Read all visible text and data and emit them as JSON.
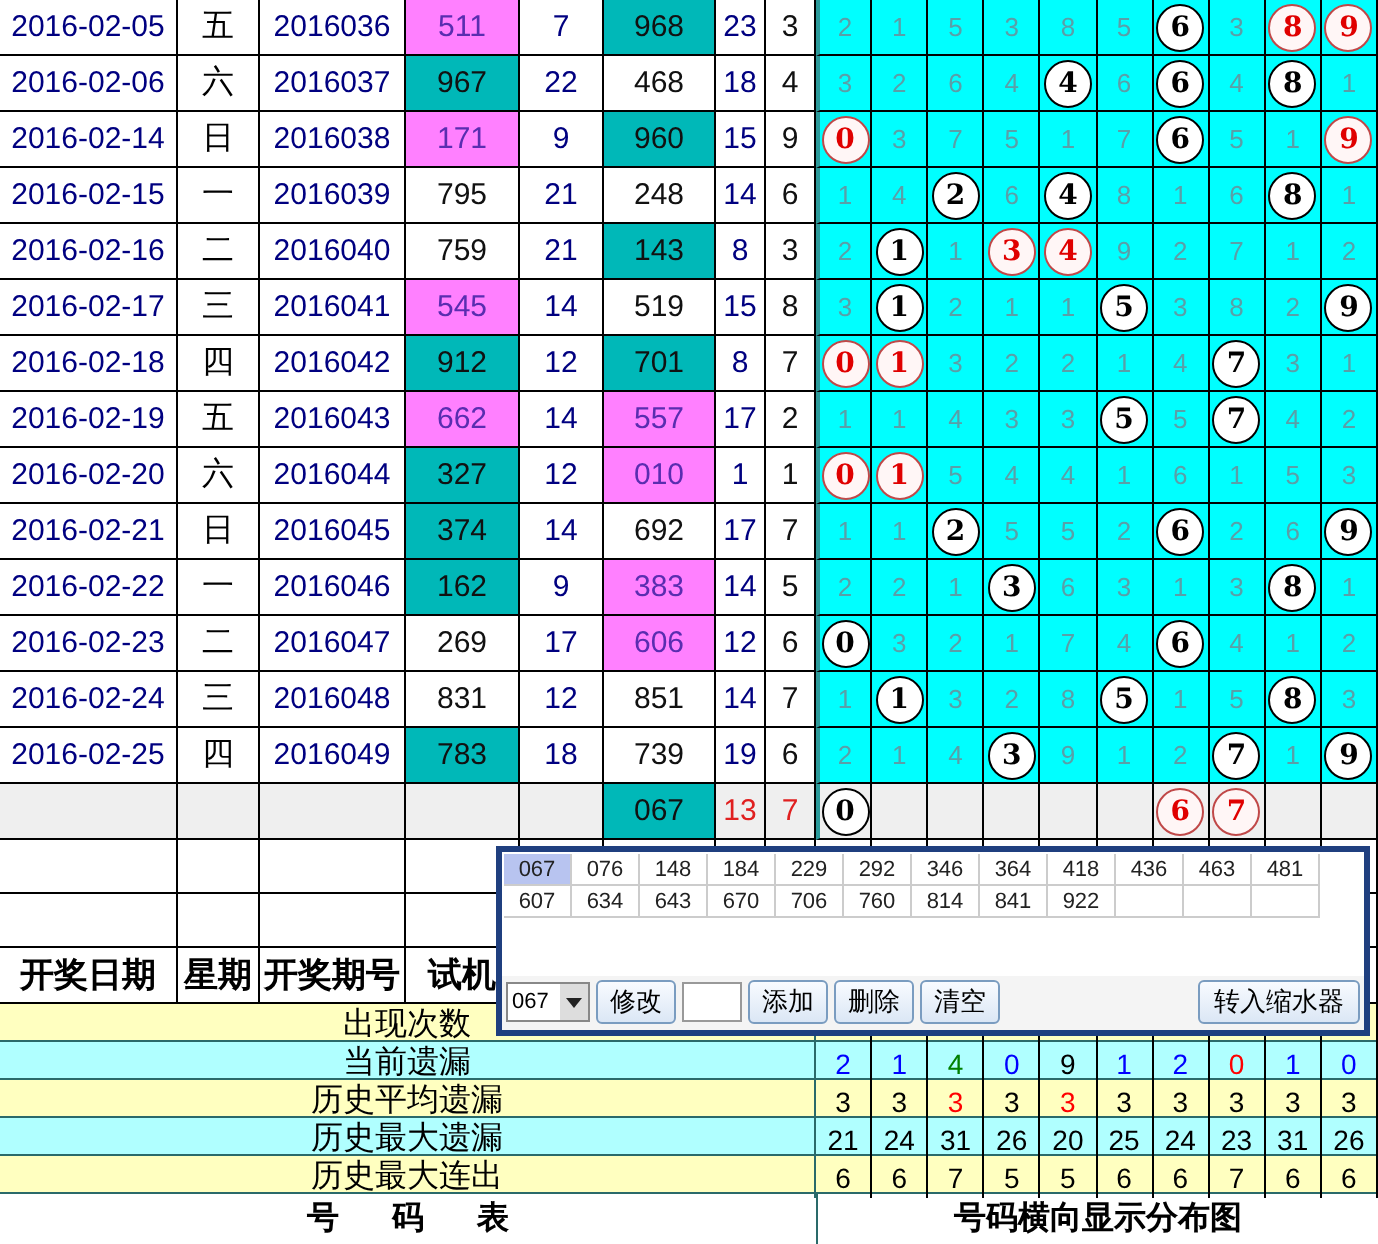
{
  "rows": [
    {
      "date": "2016-02-05",
      "weekday": "五",
      "period": "2016036",
      "trial": {
        "text": "511",
        "color": "#ff80ff"
      },
      "trial_sum": "7",
      "open": {
        "text": "968",
        "color": "#00b8b8"
      },
      "open_sum": "23",
      "span": "3",
      "digits": [
        {
          "text": "2",
          "kind": "miss"
        },
        {
          "text": "1",
          "kind": "miss"
        },
        {
          "text": "5",
          "kind": "miss"
        },
        {
          "text": "3",
          "kind": "miss"
        },
        {
          "text": "8",
          "kind": "miss"
        },
        {
          "text": "5",
          "kind": "miss"
        },
        {
          "text": "6",
          "kind": "hit"
        },
        {
          "text": "3",
          "kind": "miss"
        },
        {
          "text": "8",
          "kind": "hit_red"
        },
        {
          "text": "9",
          "kind": "hit_red"
        }
      ]
    },
    {
      "date": "2016-02-06",
      "weekday": "六",
      "period": "2016037",
      "trial": {
        "text": "967",
        "color": "#00b8b8"
      },
      "trial_sum": "22",
      "open": {
        "text": "468",
        "color": "#ffffff"
      },
      "open_sum": "18",
      "span": "4",
      "digits": [
        {
          "text": "3",
          "kind": "miss"
        },
        {
          "text": "2",
          "kind": "miss"
        },
        {
          "text": "6",
          "kind": "miss"
        },
        {
          "text": "4",
          "kind": "miss"
        },
        {
          "text": "4",
          "kind": "hit"
        },
        {
          "text": "6",
          "kind": "miss"
        },
        {
          "text": "6",
          "kind": "hit"
        },
        {
          "text": "4",
          "kind": "miss"
        },
        {
          "text": "8",
          "kind": "hit"
        },
        {
          "text": "1",
          "kind": "miss"
        }
      ]
    },
    {
      "date": "2016-02-14",
      "weekday": "日",
      "period": "2016038",
      "trial": {
        "text": "171",
        "color": "#ff80ff"
      },
      "trial_sum": "9",
      "open": {
        "text": "960",
        "color": "#00b8b8"
      },
      "open_sum": "15",
      "span": "9",
      "digits": [
        {
          "text": "0",
          "kind": "hit_red"
        },
        {
          "text": "3",
          "kind": "miss"
        },
        {
          "text": "7",
          "kind": "miss"
        },
        {
          "text": "5",
          "kind": "miss"
        },
        {
          "text": "1",
          "kind": "miss"
        },
        {
          "text": "7",
          "kind": "miss"
        },
        {
          "text": "6",
          "kind": "hit"
        },
        {
          "text": "5",
          "kind": "miss"
        },
        {
          "text": "1",
          "kind": "miss"
        },
        {
          "text": "9",
          "kind": "hit_red"
        }
      ]
    },
    {
      "date": "2016-02-15",
      "weekday": "一",
      "period": "2016039",
      "trial": {
        "text": "795",
        "color": "#ffffff"
      },
      "trial_sum": "21",
      "open": {
        "text": "248",
        "color": "#ffffff"
      },
      "open_sum": "14",
      "span": "6",
      "digits": [
        {
          "text": "1",
          "kind": "miss"
        },
        {
          "text": "4",
          "kind": "miss"
        },
        {
          "text": "2",
          "kind": "hit"
        },
        {
          "text": "6",
          "kind": "miss"
        },
        {
          "text": "4",
          "kind": "hit"
        },
        {
          "text": "8",
          "kind": "miss"
        },
        {
          "text": "1",
          "kind": "miss"
        },
        {
          "text": "6",
          "kind": "miss"
        },
        {
          "text": "8",
          "kind": "hit"
        },
        {
          "text": "1",
          "kind": "miss"
        }
      ]
    },
    {
      "date": "2016-02-16",
      "weekday": "二",
      "period": "2016040",
      "trial": {
        "text": "759",
        "color": "#ffffff"
      },
      "trial_sum": "21",
      "open": {
        "text": "143",
        "color": "#00b8b8"
      },
      "open_sum": "8",
      "span": "3",
      "digits": [
        {
          "text": "2",
          "kind": "miss"
        },
        {
          "text": "1",
          "kind": "hit"
        },
        {
          "text": "1",
          "kind": "miss"
        },
        {
          "text": "3",
          "kind": "hit_red"
        },
        {
          "text": "4",
          "kind": "hit_red"
        },
        {
          "text": "9",
          "kind": "miss"
        },
        {
          "text": "2",
          "kind": "miss"
        },
        {
          "text": "7",
          "kind": "miss"
        },
        {
          "text": "1",
          "kind": "miss"
        },
        {
          "text": "2",
          "kind": "miss"
        }
      ]
    },
    {
      "date": "2016-02-17",
      "weekday": "三",
      "period": "2016041",
      "trial": {
        "text": "545",
        "color": "#ff80ff"
      },
      "trial_sum": "14",
      "open": {
        "text": "519",
        "color": "#ffffff"
      },
      "open_sum": "15",
      "span": "8",
      "digits": [
        {
          "text": "3",
          "kind": "miss"
        },
        {
          "text": "1",
          "kind": "hit"
        },
        {
          "text": "2",
          "kind": "miss"
        },
        {
          "text": "1",
          "kind": "miss"
        },
        {
          "text": "1",
          "kind": "miss"
        },
        {
          "text": "5",
          "kind": "hit"
        },
        {
          "text": "3",
          "kind": "miss"
        },
        {
          "text": "8",
          "kind": "miss"
        },
        {
          "text": "2",
          "kind": "miss"
        },
        {
          "text": "9",
          "kind": "hit"
        }
      ]
    },
    {
      "date": "2016-02-18",
      "weekday": "四",
      "period": "2016042",
      "trial": {
        "text": "912",
        "color": "#00b8b8"
      },
      "trial_sum": "12",
      "open": {
        "text": "701",
        "color": "#00b8b8"
      },
      "open_sum": "8",
      "span": "7",
      "digits": [
        {
          "text": "0",
          "kind": "hit_red"
        },
        {
          "text": "1",
          "kind": "hit_red"
        },
        {
          "text": "3",
          "kind": "miss"
        },
        {
          "text": "2",
          "kind": "miss"
        },
        {
          "text": "2",
          "kind": "miss"
        },
        {
          "text": "1",
          "kind": "miss"
        },
        {
          "text": "4",
          "kind": "miss"
        },
        {
          "text": "7",
          "kind": "hit"
        },
        {
          "text": "3",
          "kind": "miss"
        },
        {
          "text": "1",
          "kind": "miss"
        }
      ]
    },
    {
      "date": "2016-02-19",
      "weekday": "五",
      "period": "2016043",
      "trial": {
        "text": "662",
        "color": "#ff80ff"
      },
      "trial_sum": "14",
      "open": {
        "text": "557",
        "color": "#ff80ff"
      },
      "open_sum": "17",
      "span": "2",
      "digits": [
        {
          "text": "1",
          "kind": "miss"
        },
        {
          "text": "1",
          "kind": "miss"
        },
        {
          "text": "4",
          "kind": "miss"
        },
        {
          "text": "3",
          "kind": "miss"
        },
        {
          "text": "3",
          "kind": "miss"
        },
        {
          "text": "5",
          "kind": "hit"
        },
        {
          "text": "5",
          "kind": "miss"
        },
        {
          "text": "7",
          "kind": "hit"
        },
        {
          "text": "4",
          "kind": "miss"
        },
        {
          "text": "2",
          "kind": "miss"
        }
      ]
    },
    {
      "date": "2016-02-20",
      "weekday": "六",
      "period": "2016044",
      "trial": {
        "text": "327",
        "color": "#00b8b8"
      },
      "trial_sum": "12",
      "open": {
        "text": "010",
        "color": "#ff80ff"
      },
      "open_sum": "1",
      "span": "1",
      "digits": [
        {
          "text": "0",
          "kind": "hit_red"
        },
        {
          "text": "1",
          "kind": "hit_red"
        },
        {
          "text": "5",
          "kind": "miss"
        },
        {
          "text": "4",
          "kind": "miss"
        },
        {
          "text": "4",
          "kind": "miss"
        },
        {
          "text": "1",
          "kind": "miss"
        },
        {
          "text": "6",
          "kind": "miss"
        },
        {
          "text": "1",
          "kind": "miss"
        },
        {
          "text": "5",
          "kind": "miss"
        },
        {
          "text": "3",
          "kind": "miss"
        }
      ]
    },
    {
      "date": "2016-02-21",
      "weekday": "日",
      "period": "2016045",
      "trial": {
        "text": "374",
        "color": "#00b8b8"
      },
      "trial_sum": "14",
      "open": {
        "text": "692",
        "color": "#ffffff"
      },
      "open_sum": "17",
      "span": "7",
      "digits": [
        {
          "text": "1",
          "kind": "miss"
        },
        {
          "text": "1",
          "kind": "miss"
        },
        {
          "text": "2",
          "kind": "hit"
        },
        {
          "text": "5",
          "kind": "miss"
        },
        {
          "text": "5",
          "kind": "miss"
        },
        {
          "text": "2",
          "kind": "miss"
        },
        {
          "text": "6",
          "kind": "hit"
        },
        {
          "text": "2",
          "kind": "miss"
        },
        {
          "text": "6",
          "kind": "miss"
        },
        {
          "text": "9",
          "kind": "hit"
        }
      ]
    },
    {
      "date": "2016-02-22",
      "weekday": "一",
      "period": "2016046",
      "trial": {
        "text": "162",
        "color": "#00b8b8"
      },
      "trial_sum": "9",
      "open": {
        "text": "383",
        "color": "#ff80ff"
      },
      "open_sum": "14",
      "span": "5",
      "digits": [
        {
          "text": "2",
          "kind": "miss"
        },
        {
          "text": "2",
          "kind": "miss"
        },
        {
          "text": "1",
          "kind": "miss"
        },
        {
          "text": "3",
          "kind": "hit"
        },
        {
          "text": "6",
          "kind": "miss"
        },
        {
          "text": "3",
          "kind": "miss"
        },
        {
          "text": "1",
          "kind": "miss"
        },
        {
          "text": "3",
          "kind": "miss"
        },
        {
          "text": "8",
          "kind": "hit"
        },
        {
          "text": "1",
          "kind": "miss"
        }
      ]
    },
    {
      "date": "2016-02-23",
      "weekday": "二",
      "period": "2016047",
      "trial": {
        "text": "269",
        "color": "#ffffff"
      },
      "trial_sum": "17",
      "open": {
        "text": "606",
        "color": "#ff80ff"
      },
      "open_sum": "12",
      "span": "6",
      "digits": [
        {
          "text": "0",
          "kind": "hit"
        },
        {
          "text": "3",
          "kind": "miss"
        },
        {
          "text": "2",
          "kind": "miss"
        },
        {
          "text": "1",
          "kind": "miss"
        },
        {
          "text": "7",
          "kind": "miss"
        },
        {
          "text": "4",
          "kind": "miss"
        },
        {
          "text": "6",
          "kind": "hit"
        },
        {
          "text": "4",
          "kind": "miss"
        },
        {
          "text": "1",
          "kind": "miss"
        },
        {
          "text": "2",
          "kind": "miss"
        }
      ]
    },
    {
      "date": "2016-02-24",
      "weekday": "三",
      "period": "2016048",
      "trial": {
        "text": "831",
        "color": "#ffffff"
      },
      "trial_sum": "12",
      "open": {
        "text": "851",
        "color": "#ffffff"
      },
      "open_sum": "14",
      "span": "7",
      "digits": [
        {
          "text": "1",
          "kind": "miss"
        },
        {
          "text": "1",
          "kind": "hit"
        },
        {
          "text": "3",
          "kind": "miss"
        },
        {
          "text": "2",
          "kind": "miss"
        },
        {
          "text": "8",
          "kind": "miss"
        },
        {
          "text": "5",
          "kind": "hit"
        },
        {
          "text": "1",
          "kind": "miss"
        },
        {
          "text": "5",
          "kind": "miss"
        },
        {
          "text": "8",
          "kind": "hit"
        },
        {
          "text": "3",
          "kind": "miss"
        }
      ]
    },
    {
      "date": "2016-02-25",
      "weekday": "四",
      "period": "2016049",
      "trial": {
        "text": "783",
        "color": "#00b8b8"
      },
      "trial_sum": "18",
      "open": {
        "text": "739",
        "color": "#ffffff"
      },
      "open_sum": "19",
      "span": "6",
      "digits": [
        {
          "text": "2",
          "kind": "miss"
        },
        {
          "text": "1",
          "kind": "miss"
        },
        {
          "text": "4",
          "kind": "miss"
        },
        {
          "text": "3",
          "kind": "hit"
        },
        {
          "text": "9",
          "kind": "miss"
        },
        {
          "text": "1",
          "kind": "miss"
        },
        {
          "text": "2",
          "kind": "miss"
        },
        {
          "text": "7",
          "kind": "hit"
        },
        {
          "text": "1",
          "kind": "miss"
        },
        {
          "text": "9",
          "kind": "hit"
        }
      ]
    }
  ],
  "forecast_row": {
    "open": {
      "text": "067",
      "color": "#00b8b8"
    },
    "open_sum": "13",
    "span": "7",
    "digits": [
      {
        "text": "0",
        "kind": "hit"
      },
      {
        "kind": "empty"
      },
      {
        "kind": "empty"
      },
      {
        "kind": "empty"
      },
      {
        "kind": "empty"
      },
      {
        "kind": "empty"
      },
      {
        "text": "6",
        "kind": "hit_red"
      },
      {
        "text": "7",
        "kind": "hit_red"
      },
      {
        "kind": "empty"
      },
      {
        "kind": "empty"
      }
    ]
  },
  "header": [
    "开奖日期",
    "星期",
    "开奖期号",
    "试机"
  ],
  "stats": [
    {
      "label": "出现次数"
    },
    {
      "label": "当前遗漏",
      "values": [
        {
          "text": "2",
          "color": "#0000ff"
        },
        {
          "text": "1",
          "color": "#0000ff"
        },
        {
          "text": "4",
          "color": "#008000"
        },
        {
          "text": "0",
          "color": "#0000ff"
        },
        {
          "text": "9",
          "color": "#000000"
        },
        {
          "text": "1",
          "color": "#0000ff"
        },
        {
          "text": "2",
          "color": "#0000ff"
        },
        {
          "text": "0",
          "color": "#ff0000"
        },
        {
          "text": "1",
          "color": "#0000ff"
        },
        {
          "text": "0",
          "color": "#0000ff"
        }
      ]
    },
    {
      "label": "历史平均遗漏",
      "values": [
        {
          "text": "3",
          "color": "#000000"
        },
        {
          "text": "3",
          "color": "#000000"
        },
        {
          "text": "3",
          "color": "#ff0000"
        },
        {
          "text": "3",
          "color": "#000000"
        },
        {
          "text": "3",
          "color": "#ff0000"
        },
        {
          "text": "3",
          "color": "#000000"
        },
        {
          "text": "3",
          "color": "#000000"
        },
        {
          "text": "3",
          "color": "#000000"
        },
        {
          "text": "3",
          "color": "#000000"
        },
        {
          "text": "3",
          "color": "#000000"
        }
      ]
    },
    {
      "label": "历史最大遗漏",
      "values": [
        {
          "text": "21",
          "color": "#000000"
        },
        {
          "text": "24",
          "color": "#000000"
        },
        {
          "text": "31",
          "color": "#000000"
        },
        {
          "text": "26",
          "color": "#000000"
        },
        {
          "text": "20",
          "color": "#000000"
        },
        {
          "text": "25",
          "color": "#000000"
        },
        {
          "text": "24",
          "color": "#000000"
        },
        {
          "text": "23",
          "color": "#000000"
        },
        {
          "text": "31",
          "color": "#000000"
        },
        {
          "text": "26",
          "color": "#000000"
        }
      ]
    },
    {
      "label": "历史最大连出",
      "values": [
        {
          "text": "6",
          "color": "#000000"
        },
        {
          "text": "6",
          "color": "#000000"
        },
        {
          "text": "7",
          "color": "#000000"
        },
        {
          "text": "5",
          "color": "#000000"
        },
        {
          "text": "5",
          "color": "#000000"
        },
        {
          "text": "6",
          "color": "#000000"
        },
        {
          "text": "6",
          "color": "#000000"
        },
        {
          "text": "7",
          "color": "#000000"
        },
        {
          "text": "6",
          "color": "#000000"
        },
        {
          "text": "6",
          "color": "#000000"
        }
      ]
    }
  ],
  "footer": {
    "left": "号 码 表",
    "right": "号码横向显示分布图"
  },
  "dialog": {
    "numbers": [
      {
        "text": "067",
        "selected": true
      },
      {
        "text": "076",
        "selected": false
      },
      {
        "text": "148",
        "selected": false
      },
      {
        "text": "184",
        "selected": false
      },
      {
        "text": "229",
        "selected": false
      },
      {
        "text": "292",
        "selected": false
      },
      {
        "text": "346",
        "selected": false
      },
      {
        "text": "364",
        "selected": false
      },
      {
        "text": "418",
        "selected": false
      },
      {
        "text": "436",
        "selected": false
      },
      {
        "text": "463",
        "selected": false
      },
      {
        "text": "481",
        "selected": false
      },
      {
        "text": "607",
        "selected": false
      },
      {
        "text": "634",
        "selected": false
      },
      {
        "text": "643",
        "selected": false
      },
      {
        "text": "670",
        "selected": false
      },
      {
        "text": "706",
        "selected": false
      },
      {
        "text": "760",
        "selected": false
      },
      {
        "text": "814",
        "selected": false
      },
      {
        "text": "841",
        "selected": false
      },
      {
        "text": "922",
        "selected": false
      }
    ],
    "combo_value": "067",
    "edit_button": "修改",
    "buttons": [
      "添加",
      "删除",
      "清空"
    ],
    "transfer_button": "转入缩水器"
  }
}
